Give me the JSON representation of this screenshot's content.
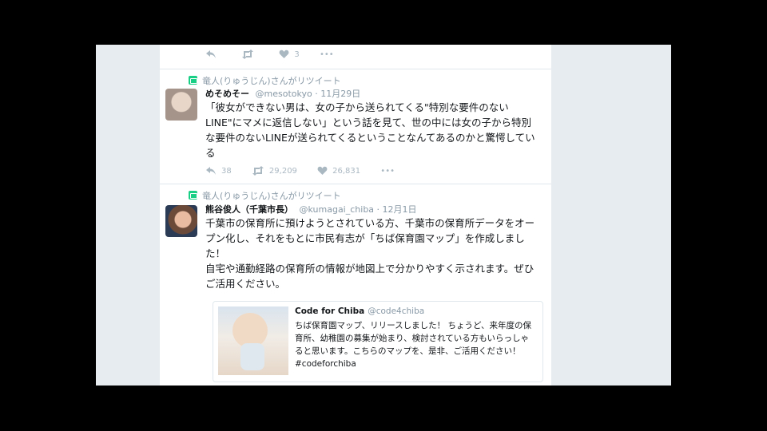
{
  "colors": {
    "retweet_icon": "#19cf86",
    "muted": "#8899a6",
    "text": "#14171a"
  },
  "tweet0": {
    "actions": {
      "reply": "",
      "retweet": "",
      "like": "3",
      "more": "•••"
    }
  },
  "tweet1": {
    "retweeted_by": "竜人(りゅうじん)さんがリツイート",
    "name": "めそめそー",
    "handle": "@mesotokyo",
    "date": "11月29日",
    "text": "「彼女ができない男は、女の子から送られてくる\"特別な要件のないLINE\"にマメに返信しない」という話を見て、世の中には女の子から特別な要件のないLINEが送られてくるということなんてあるのかと驚愕している",
    "actions": {
      "reply": "38",
      "retweet": "29,209",
      "like": "26,831",
      "more": "•••"
    }
  },
  "tweet2": {
    "retweeted_by": "竜人(りゅうじん)さんがリツイート",
    "name": "熊谷俊人（千葉市長）",
    "handle": "@kumagai_chiba",
    "date": "12月1日",
    "text": "千葉市の保育所に預けようとされている方、千葉市の保育所データをオープン化し、それをもとに市民有志が「ちば保育園マップ」を作成しました！\n自宅や通勤経路の保育所の情報が地図上で分かりやすく示されます。ぜひご活用ください。",
    "card": {
      "name": "Code for Chiba",
      "handle": "@code4chiba",
      "text": "ちば保育園マップ、リリースしました！ ちょうど、来年度の保育所、幼稚園の募集が始まり、検討されている方もいらっしゃると思います。こちらのマップを、是非、ご活用ください！ #codeforchiba"
    }
  }
}
